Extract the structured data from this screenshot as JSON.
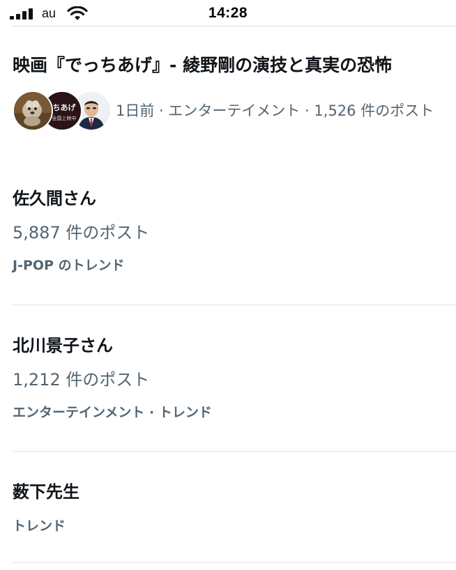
{
  "status_bar": {
    "carrier": "au",
    "time": "14:28",
    "signal_icon": "cellular-signal-icon",
    "wifi_icon": "wifi-icon"
  },
  "news": {
    "title": "映画『でっちあげ』- 綾野剛の演技と真実の恐怖",
    "meta": "1日前 · エンターテイメント · 1,526 件のポスト",
    "avatars": [
      "dog-photo-avatar",
      "movie-poster-avatar",
      "man-in-suit-avatar"
    ],
    "poster_text": "ちあげ",
    "poster_subtext": "全国上映中"
  },
  "trends": [
    {
      "title": "佐久間さん",
      "count": "5,887 件のポスト",
      "context": "J-POP のトレンド"
    },
    {
      "title": "北川景子さん",
      "count": "1,212 件のポスト",
      "context": "エンターテインメント · トレンド"
    },
    {
      "title": "薮下先生",
      "context": "トレンド"
    }
  ],
  "colors": {
    "primary_text": "#0f1419",
    "secondary_text": "#536471",
    "divider": "#e2e6e9"
  }
}
